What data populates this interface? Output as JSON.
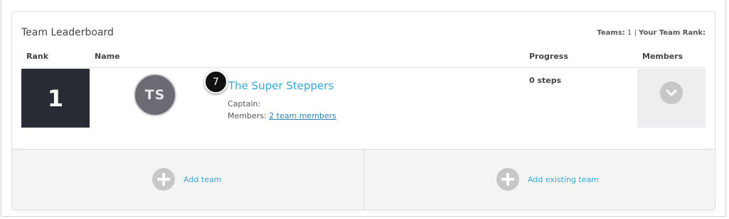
{
  "leaderboard": {
    "title": "Team Leaderboard",
    "teams_label": "Teams:",
    "teams_count": "1",
    "separator": "|",
    "rank_label": "Your Team Rank:",
    "rank_value": ""
  },
  "columns": {
    "rank": "Rank",
    "name": "Name",
    "progress": "Progress",
    "members": "Members"
  },
  "rows": [
    {
      "rank": "1",
      "initials": "TS",
      "step_badge": "7",
      "team_name": "The Super Steppers",
      "captain_label": "Captain:",
      "members_label": "Members:",
      "members_link": "2 team members",
      "progress": "0 steps",
      "expand_icon": "chevron-down-icon"
    }
  ],
  "actions": {
    "add_team": "Add team",
    "add_existing_team": "Add existing team",
    "icon": "plus-icon"
  },
  "colors": {
    "rank_bg": "#272b33",
    "link": "#3ba6d8",
    "avatar": "#6b6b73",
    "icon_gray": "#c6c7c9"
  }
}
